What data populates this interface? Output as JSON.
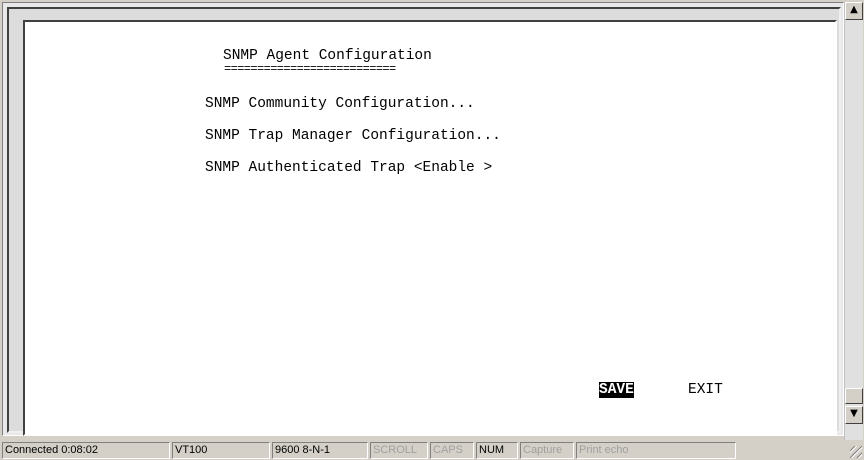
{
  "terminal": {
    "title": "SNMP Agent Configuration",
    "underline": "==========================",
    "menu": [
      "SNMP Community Configuration...",
      "SNMP Trap Manager Configuration...",
      "SNMP Authenticated Trap <Enable >"
    ],
    "actions": {
      "save": "SAVE",
      "exit": "EXIT"
    }
  },
  "scrollbar": {
    "up_icon": "up-arrow-icon",
    "down_icon": "down-arrow-icon"
  },
  "status": {
    "connected": "Connected 0:08:02",
    "emulation": "VT100",
    "port": "9600 8-N-1",
    "scroll": "SCROLL",
    "caps": "CAPS",
    "num": "NUM",
    "capture": "Capture",
    "print_echo": "Print echo"
  }
}
